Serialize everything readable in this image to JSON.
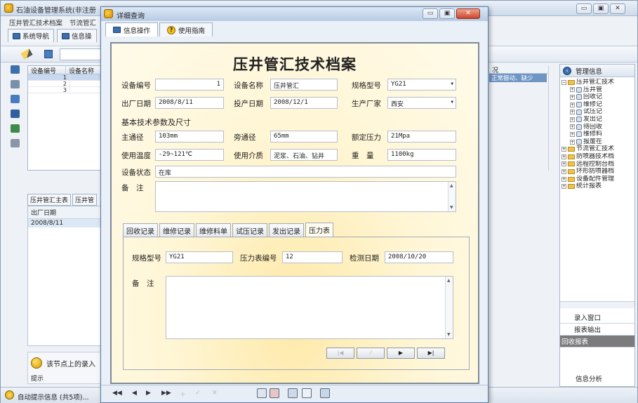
{
  "bg_window": {
    "title": "石油设备管理系统(非注册",
    "menu": [
      "压井管汇技术档案",
      "节流管汇"
    ],
    "tabs": [
      "系统导航",
      "信息操"
    ],
    "grid_headers": [
      "设备编号",
      "设备名称"
    ],
    "grid_rows": [
      "1",
      "2",
      "3"
    ],
    "sub_tabs": [
      "压井管汇主表",
      "压井管"
    ],
    "sub_grid_header": "出厂日期",
    "sub_grid_value": "2008/8/11",
    "tip_text": "该节点上的录入",
    "tip_label": "提示",
    "status_text": "自动提示信息 (共5项)...",
    "right_grid_header": "况",
    "right_grid_cell": "正常振动、缺少"
  },
  "right_panel": {
    "title": "管理信息",
    "tree": [
      {
        "label": "压井管汇技术",
        "level": 0,
        "type": "folder",
        "expanded": true
      },
      {
        "label": "压井管",
        "level": 1,
        "type": "leaf"
      },
      {
        "label": "回收记",
        "level": 1,
        "type": "leaf"
      },
      {
        "label": "维修记",
        "level": 1,
        "type": "leaf"
      },
      {
        "label": "试压记",
        "level": 1,
        "type": "leaf"
      },
      {
        "label": "发出记",
        "level": 1,
        "type": "leaf"
      },
      {
        "label": "待回收",
        "level": 1,
        "type": "leaf"
      },
      {
        "label": "维修料",
        "level": 1,
        "type": "leaf"
      },
      {
        "label": "报废在",
        "level": 1,
        "type": "leaf"
      },
      {
        "label": "节流管汇技术",
        "level": 0,
        "type": "folder"
      },
      {
        "label": "防喷器技术档",
        "level": 0,
        "type": "folder"
      },
      {
        "label": "远程控制台档",
        "level": 0,
        "type": "folder"
      },
      {
        "label": "环形防喷器档",
        "level": 0,
        "type": "folder"
      },
      {
        "label": "设备配件管理",
        "level": 0,
        "type": "folder"
      },
      {
        "label": "统计报表",
        "level": 0,
        "type": "folder"
      }
    ],
    "links": [
      "录入窗口",
      "报表输出",
      "回收报表"
    ],
    "bottom_label": "信息分析"
  },
  "dialog": {
    "title": "详细查询",
    "tabs": [
      "信息操作",
      "使用指南"
    ],
    "form_title": "压井管汇技术档案",
    "fields": {
      "equip_no_label": "设备编号",
      "equip_no": "1",
      "equip_name_label": "设备名称",
      "equip_name": "压井管汇",
      "spec_label": "规格型号",
      "spec": "YG21",
      "mfg_date_label": "出厂日期",
      "mfg_date": "2008/8/11",
      "prod_date_label": "投产日期",
      "prod_date": "2008/12/1",
      "maker_label": "生产厂家",
      "maker": "西安",
      "section_title": "基本技术参数及尺寸",
      "main_bore_label": "主通径",
      "main_bore": "103mm",
      "side_bore_label": "旁通径",
      "side_bore": "65mm",
      "pressure_label": "额定压力",
      "pressure": "21Mpa",
      "temp_label": "使用温度",
      "temp": "-29~121℃",
      "medium_label": "使用介质",
      "medium": "泥浆、石油、钻井",
      "weight_label": "重　量",
      "weight": "1100kg",
      "status_label": "设备状态",
      "status": "在库",
      "remark_label": "备　注"
    },
    "inner_tabs": [
      "回收记录",
      "维修记录",
      "维修料单",
      "试压记录",
      "发出记录",
      "压力表"
    ],
    "pressure_tab": {
      "spec_label": "规格型号",
      "spec": "YG21",
      "gauge_no_label": "压力表编号",
      "gauge_no": "12",
      "check_date_label": "检测日期",
      "check_date": "2008/10/20",
      "remark_label": "备　注"
    },
    "nav_buttons": [
      "|◀",
      "⁄",
      "▶",
      "▶|"
    ],
    "bottom_nav": [
      "◀◀",
      "◀",
      "▶",
      "▶▶"
    ]
  }
}
